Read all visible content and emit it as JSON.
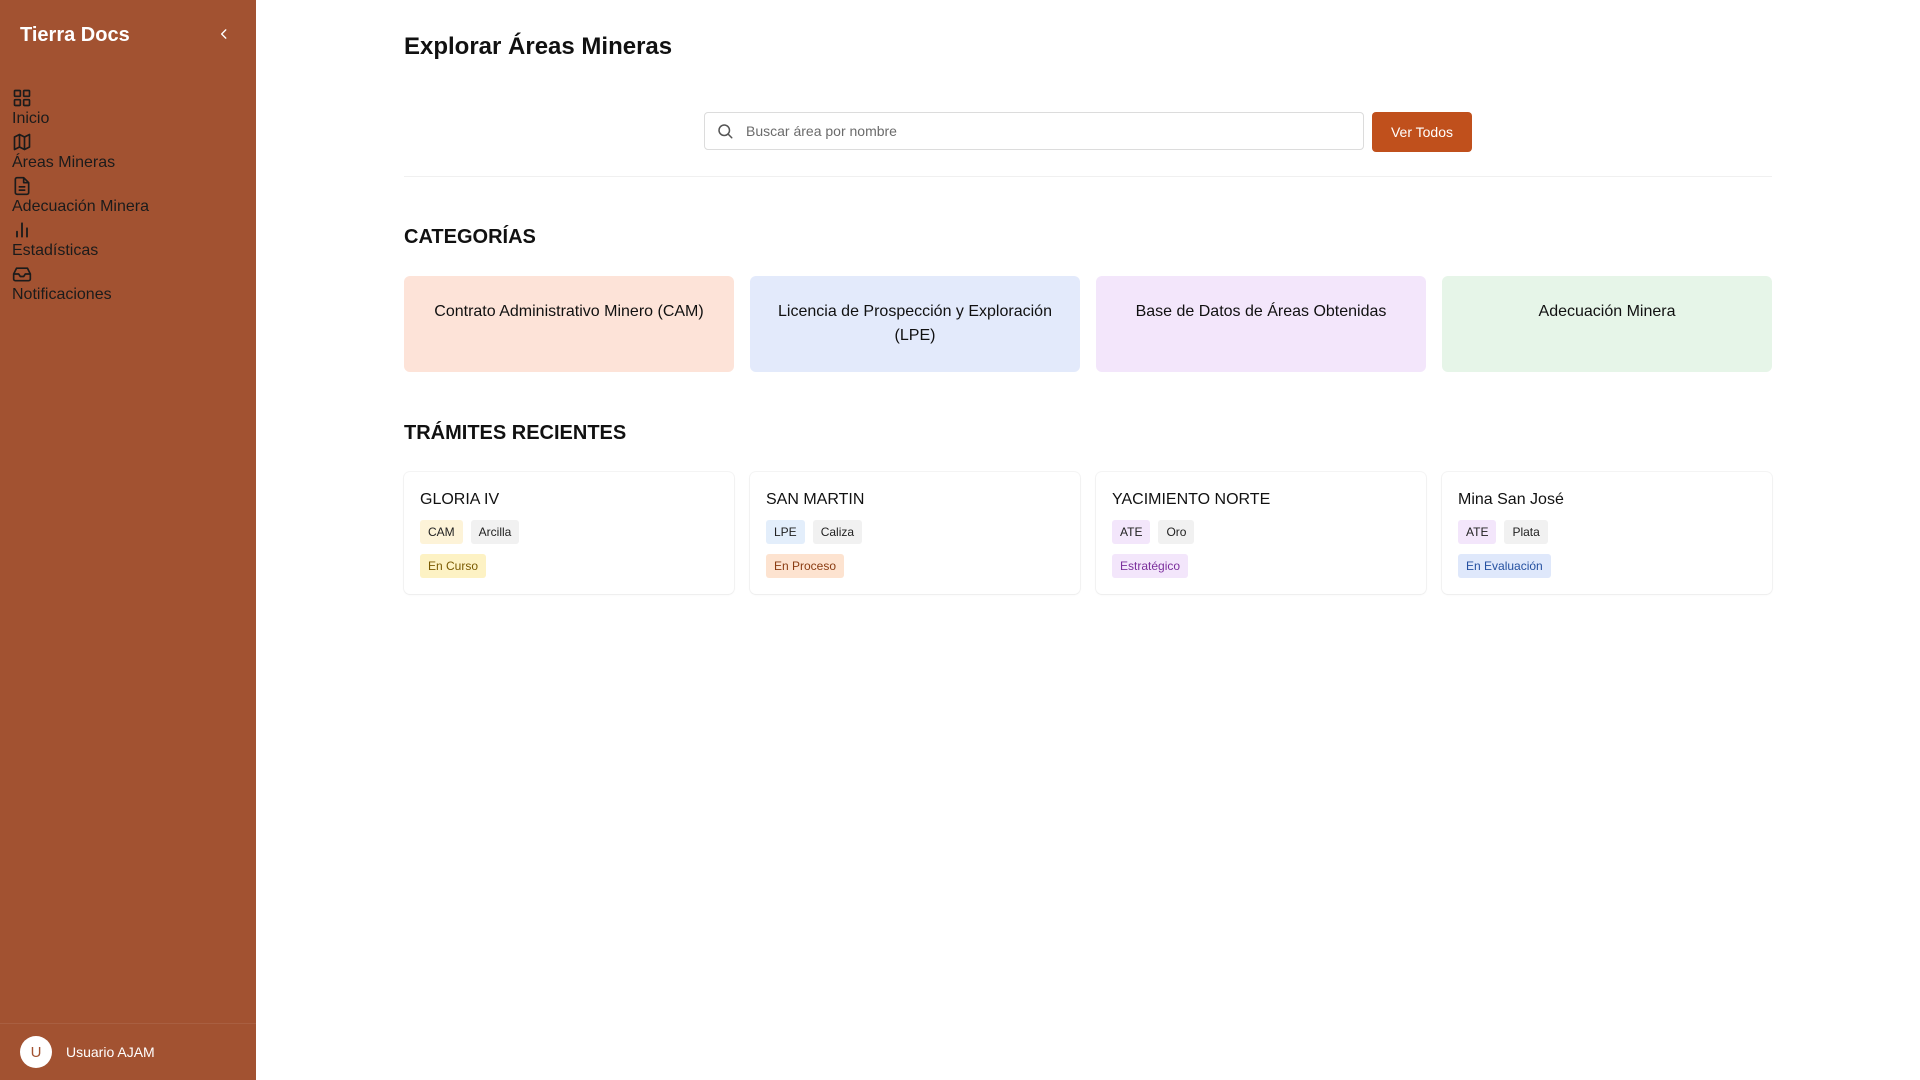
{
  "sidebar": {
    "brand": "Tierra Docs",
    "items": [
      {
        "label": "Inicio",
        "icon": "dashboard-icon"
      },
      {
        "label": "Áreas Mineras",
        "icon": "map-icon"
      },
      {
        "label": "Adecuación Minera",
        "icon": "document-icon"
      },
      {
        "label": "Estadísticas",
        "icon": "bar-chart-icon"
      },
      {
        "label": "Notificaciones",
        "icon": "inbox-icon"
      }
    ],
    "user": {
      "initial": "U",
      "name": "Usuario AJAM"
    },
    "color": "#a25231"
  },
  "header": {
    "title": "Explorar Áreas Mineras"
  },
  "search": {
    "placeholder": "Buscar área por nombre",
    "value": "",
    "button": "Ver Todos"
  },
  "categories": {
    "title": "CATEGORÍAS",
    "items": [
      {
        "label": "Contrato Administrativo Minero (CAM)",
        "color": "#fde3d8"
      },
      {
        "label": "Licencia de Prospección y Exploración (LPE)",
        "color": "#e3eafb"
      },
      {
        "label": "Base de Datos de Áreas Obtenidas",
        "color": "#f3e6fb"
      },
      {
        "label": "Adecuación Minera",
        "color": "#e6f5e8"
      }
    ]
  },
  "recent": {
    "title": "TRÁMITES RECIENTES",
    "items": [
      {
        "name": "GLORIA IV",
        "type": "CAM",
        "mineral": "Arcilla",
        "status": "En Curso",
        "type_bg": "#fdf3d8",
        "status_bg": "#fdf2c4",
        "status_color": "#7a5a00"
      },
      {
        "name": "SAN MARTIN",
        "type": "LPE",
        "mineral": "Caliza",
        "status": "En Proceso",
        "type_bg": "#e3eefb",
        "status_bg": "#fde3d0",
        "status_color": "#8a3c12"
      },
      {
        "name": "YACIMIENTO NORTE",
        "type": "ATE",
        "mineral": "Oro",
        "status": "Estratégico",
        "type_bg": "#f3e6fb",
        "status_bg": "#f3e6fb",
        "status_color": "#7b2f9c"
      },
      {
        "name": "Mina San José",
        "type": "ATE",
        "mineral": "Plata",
        "status": "En Evaluación",
        "type_bg": "#f3e6fb",
        "status_bg": "#dfe8fb",
        "status_color": "#2450a0"
      }
    ]
  },
  "accent": "#c0501c"
}
